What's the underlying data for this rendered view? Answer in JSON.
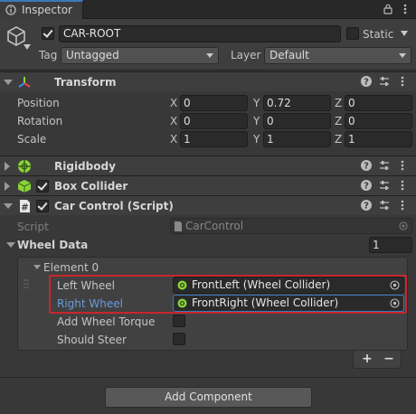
{
  "window": {
    "tab_title": "Inspector"
  },
  "header": {
    "object_name": "CAR-ROOT",
    "active_checked": true,
    "static_label": "Static",
    "tag_label": "Tag",
    "tag_value": "Untagged",
    "layer_label": "Layer",
    "layer_value": "Default"
  },
  "transform": {
    "title": "Transform",
    "rows": [
      {
        "label": "Position",
        "x": "0",
        "y": "0.72",
        "z": "0"
      },
      {
        "label": "Rotation",
        "x": "0",
        "y": "0",
        "z": "0"
      },
      {
        "label": "Scale",
        "x": "1",
        "y": "1",
        "z": "1"
      }
    ],
    "axis": {
      "x": "X",
      "y": "Y",
      "z": "Z"
    }
  },
  "components": {
    "rigidbody": "Rigidbody",
    "box_collider": "Box Collider",
    "car_control": "Car Control (Script)"
  },
  "car_control": {
    "script_label": "Script",
    "script_value": "CarControl",
    "wheel_data_label": "Wheel Data",
    "wheel_data_size": "1",
    "element_label": "Element 0",
    "left_wheel_label": "Left Wheel",
    "left_wheel_value": "FrontLeft (Wheel Collider)",
    "right_wheel_label": "Right Wheel",
    "right_wheel_value": "FrontRight (Wheel Collider)",
    "torque_label": "Add Wheel Torque",
    "steer_label": "Should Steer",
    "plus": "+",
    "minus": "−"
  },
  "add_component": "Add Component",
  "colors": {
    "accent": "#3a79bb",
    "highlight": "#c8262c",
    "label_blue": "#6a9cde"
  }
}
